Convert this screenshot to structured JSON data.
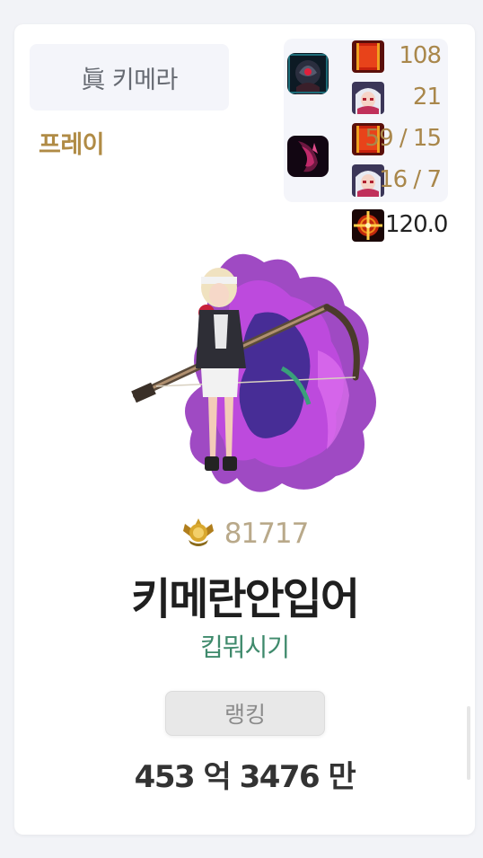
{
  "card": {
    "class_name": "眞 키메라",
    "server": "프레이",
    "character_name": "키메란안입어",
    "guild": "킵뭐시기",
    "fame": "81717",
    "rank_button": "랭킹",
    "damage": "453 억 3476 만"
  },
  "gear_panel": {
    "stats": [
      "108",
      "21",
      "59 / 15",
      "16 / 7",
      "120.0"
    ],
    "icons": [
      "creature-icon",
      "aura-icon",
      "title-book-icon",
      "character-portrait-icon",
      "crosshair-icon"
    ]
  },
  "colors": {
    "server": "#b08b45",
    "stat": "#a9874b",
    "guild": "#3f8a6c",
    "fame": "#b9a98a",
    "name": "#1f1f1f"
  }
}
